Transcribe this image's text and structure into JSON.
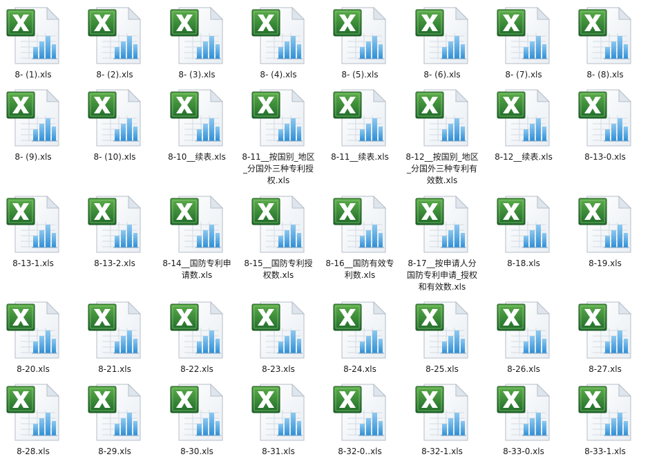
{
  "window": {
    "view": "large-icons"
  },
  "icon": {
    "name": "excel-spreadsheet-icon",
    "badge_letter": "X",
    "accent": "#2e7d32",
    "chart_color": "#3a9ad9"
  },
  "files": [
    {
      "name": "8- (1).xls"
    },
    {
      "name": "8- (2).xls"
    },
    {
      "name": "8- (3).xls"
    },
    {
      "name": "8- (4).xls"
    },
    {
      "name": "8- (5).xls"
    },
    {
      "name": "8- (6).xls"
    },
    {
      "name": "8- (7).xls"
    },
    {
      "name": "8- (8).xls"
    },
    {
      "name": "8- (9).xls"
    },
    {
      "name": "8- (10).xls"
    },
    {
      "name": "8-10__续表.xls"
    },
    {
      "name": "8-11__按国别_地区_分国外三种专利授权.xls"
    },
    {
      "name": "8-11__续表.xls"
    },
    {
      "name": "8-12__按国别_地区_分国外三种专利有效数.xls"
    },
    {
      "name": "8-12__续表.xls"
    },
    {
      "name": "8-13-0.xls"
    },
    {
      "name": "8-13-1.xls"
    },
    {
      "name": "8-13-2.xls"
    },
    {
      "name": "8-14__国防专利申请数.xls"
    },
    {
      "name": "8-15__国防专利授权数.xls"
    },
    {
      "name": "8-16__国防有效专利数.xls"
    },
    {
      "name": "8-17__按申请人分国防专利申请_授权和有效数.xls"
    },
    {
      "name": "8-18.xls"
    },
    {
      "name": "8-19.xls"
    },
    {
      "name": "8-20.xls"
    },
    {
      "name": "8-21.xls"
    },
    {
      "name": "8-22.xls"
    },
    {
      "name": "8-23.xls"
    },
    {
      "name": "8-24.xls"
    },
    {
      "name": "8-25.xls"
    },
    {
      "name": "8-26.xls"
    },
    {
      "name": "8-27.xls"
    },
    {
      "name": "8-28.xls"
    },
    {
      "name": "8-29.xls"
    },
    {
      "name": "8-30.xls"
    },
    {
      "name": "8-31.xls"
    },
    {
      "name": "8-32-0..xls"
    },
    {
      "name": "8-32-1.xls"
    },
    {
      "name": "8-33-0.xls"
    },
    {
      "name": "8-33-1.xls"
    }
  ]
}
